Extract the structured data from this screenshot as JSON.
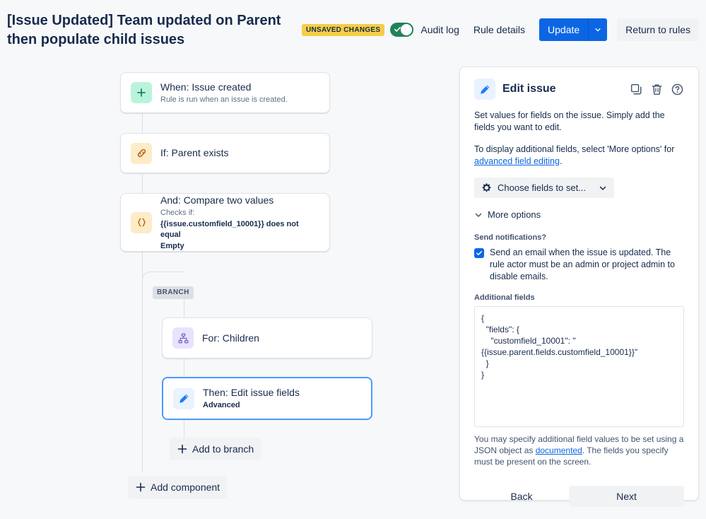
{
  "header": {
    "rule_title": "[Issue Updated] Team updated on Parent then populate child issues",
    "unsaved_badge": "UNSAVED CHANGES",
    "toggle_state": "on",
    "audit_log": "Audit log",
    "rule_details": "Rule details",
    "update_button": "Update",
    "return_button": "Return to rules"
  },
  "canvas": {
    "branch_tag": "BRANCH",
    "add_to_branch": "Add to branch",
    "add_component": "Add component",
    "cards": [
      {
        "title": "When: Issue created",
        "subtitle": "Rule is run when an issue is created.",
        "icon": "plus-icon",
        "icon_style": "green"
      },
      {
        "title": "If: Parent exists",
        "subtitle": "",
        "icon": "link-icon",
        "icon_style": "amber"
      },
      {
        "title": "And: Compare two values",
        "subtitle_line1": "Checks if:",
        "subtitle_line2": "{{issue.customfield_10001}} does not equal",
        "subtitle_line3": "Empty",
        "icon": "braces-icon",
        "icon_style": "amber"
      },
      {
        "title": "For: Children",
        "subtitle": "",
        "icon": "hierarchy-icon",
        "icon_style": "purple"
      },
      {
        "title": "Then: Edit issue fields",
        "subtitle": "Advanced",
        "icon": "pencil-icon",
        "icon_style": "blue",
        "selected": true
      }
    ]
  },
  "panel": {
    "title": "Edit issue",
    "icon": "pencil-icon",
    "actions": [
      "copy-icon",
      "trash-icon",
      "help-icon"
    ],
    "description": "Set values for fields on the issue. Simply add the fields you want to edit.",
    "hint_prefix": "To display additional fields, select 'More options' for ",
    "hint_link": "advanced field editing",
    "hint_suffix": ".",
    "choose_fields_label": "Choose fields to set...",
    "more_options_label": "More options",
    "send_notifications_label": "Send notifications?",
    "send_email_checkbox_label": "Send an email when the issue is updated. The rule actor must be an admin or project admin to disable emails.",
    "send_email_checked": true,
    "additional_fields_label": "Additional fields",
    "additional_fields_value": "{\n  \"fields\": {\n    \"customfield_10001\": \"{{issue.parent.fields.customfield_10001}}\"\n  }\n}",
    "help_prefix": "You may specify additional field values to be set using a JSON object as ",
    "help_link": "documented",
    "help_suffix": ". The fields you specify must be present on the screen.",
    "back_button": "Back",
    "next_button": "Next"
  },
  "colors": {
    "accent": "#0c66e4",
    "page_bg": "#f7f8f9",
    "badge_yellow": "#f5cd47",
    "toggle_green": "#1f845a",
    "selected_border": "#4c9aff"
  }
}
